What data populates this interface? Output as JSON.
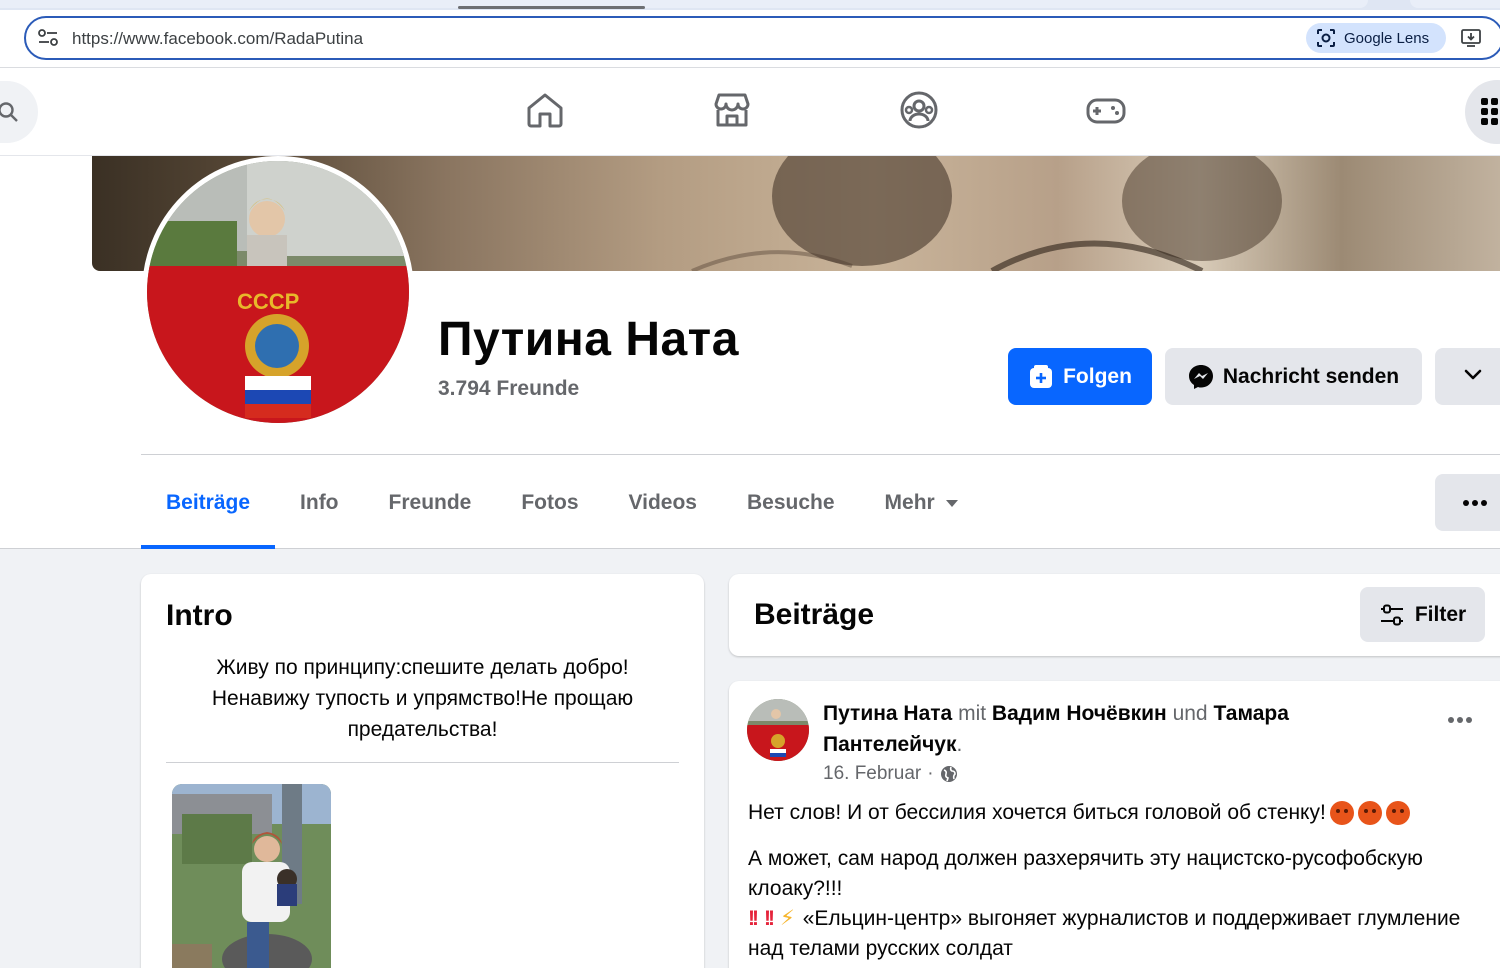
{
  "browser": {
    "url": "https://www.facebook.com/RadaPutina",
    "lens_label": "Google Lens"
  },
  "fb_nav": {
    "icons": [
      "search-icon",
      "home-icon",
      "marketplace-icon",
      "groups-icon",
      "gaming-icon",
      "menu-grid-icon"
    ]
  },
  "profile": {
    "name": "Путина Ната",
    "friends": "3.794 Freunde",
    "follow_label": "Folgen",
    "message_label": "Nachricht senden"
  },
  "tabs": [
    {
      "label": "Beiträge"
    },
    {
      "label": "Info"
    },
    {
      "label": "Freunde"
    },
    {
      "label": "Fotos"
    },
    {
      "label": "Videos"
    },
    {
      "label": "Besuche"
    },
    {
      "label": "Mehr"
    }
  ],
  "intro": {
    "title": "Intro",
    "bio": "Живу по принципу:спешите делать добро! Ненавижу тупость и упрямство!Не прощаю предательства!"
  },
  "posts": {
    "title": "Beiträge",
    "filter_label": "Filter"
  },
  "post": {
    "author": "Путина Ната",
    "mit": "mit",
    "tagged1": "Вадим Ночёвкин",
    "und": "und",
    "tagged2": "Тамара Пантелейчук",
    "period": ".",
    "date": "16. Februar",
    "sep": "·",
    "line1": "Нет слов! И от бессилия хочется биться головой об стенку!",
    "line2": "А может, сам народ должен разхерячить эту нацистско-русофобскую клоаку?!!!",
    "line3": "«Ельцин-центр» выгоняет журналистов и поддерживает глумление над телами русских солдат"
  },
  "colors": {
    "fb_blue": "#0866ff",
    "button_grey": "#e4e6eb",
    "text_secondary": "#65676b",
    "page_bg": "#f0f2f5"
  }
}
